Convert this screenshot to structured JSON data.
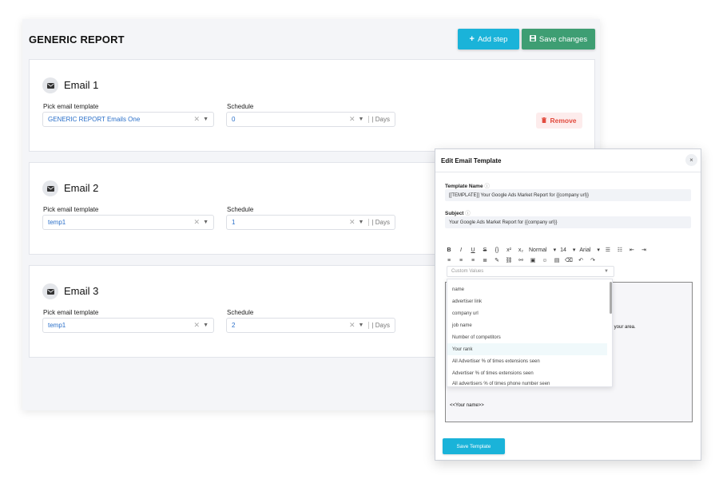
{
  "report": {
    "title": "GENERIC REPORT",
    "add_step_label": "Add step",
    "save_changes_label": "Save changes"
  },
  "labels": {
    "pick_template": "Pick email template",
    "schedule": "Schedule",
    "days": "| Days",
    "remove": "Remove"
  },
  "emails": [
    {
      "title": "Email 1",
      "template": "GENERIC REPORT Emails One",
      "schedule": "0"
    },
    {
      "title": "Email 2",
      "template": "temp1",
      "schedule": "1"
    },
    {
      "title": "Email 3",
      "template": "temp1",
      "schedule": "2"
    }
  ],
  "modal": {
    "title": "Edit Email Template",
    "close": "×",
    "template_name_label": "Template Name",
    "template_name_value": "[[TEMPLATE]] Your Google Ads Market Report for {{company url}}",
    "subject_label": "Subject",
    "subject_value": "Your Google Ads Market Report for {{company url}}",
    "font_style": "Normal",
    "font_size": "14",
    "font_family": "Arial",
    "custom_values_placeholder": "Custom Values",
    "editor_fragment": "isers in your area.",
    "editor_signature": "<<Your name>>",
    "save_template_label": "Save Template"
  },
  "custom_values": [
    "name",
    "advertiser link",
    "company url",
    "job name",
    "Number of competitors",
    "Your rank",
    "All Advertiser % of times extensions seen",
    "Advertiser % of times extensions seen",
    "All advertisers % of times phone number seen"
  ],
  "colors": {
    "accent": "#1ab3d9",
    "save_green": "#3e9e73",
    "remove_red": "#e24c3f"
  }
}
